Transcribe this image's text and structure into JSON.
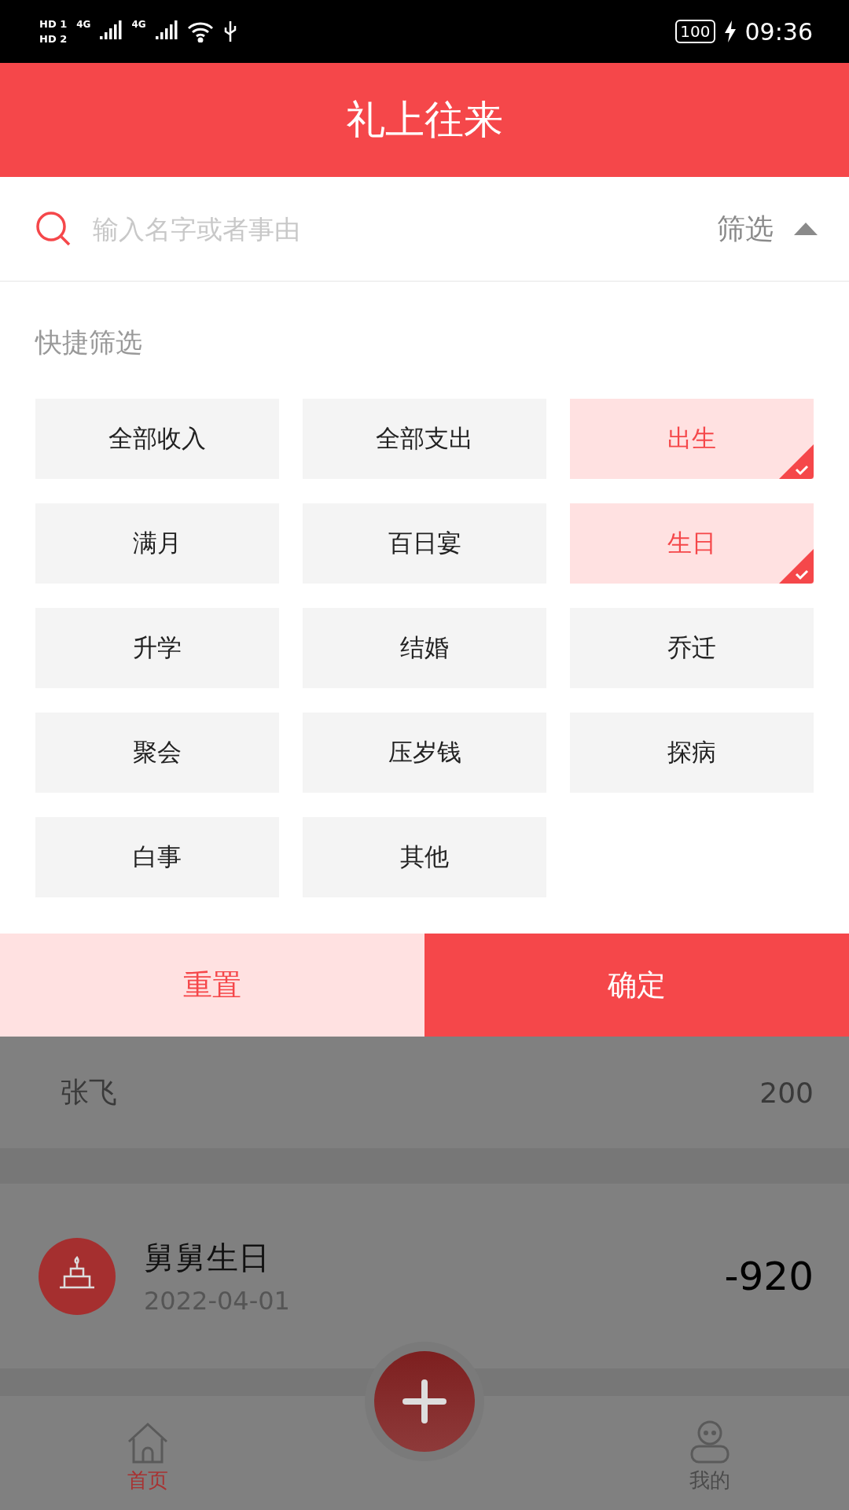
{
  "status_bar": {
    "sims": [
      {
        "label": "HD",
        "slot": "1"
      },
      {
        "label": "HD",
        "slot": "2"
      }
    ],
    "networks": [
      "4G",
      "4G"
    ],
    "battery": "100",
    "time": "09:36"
  },
  "header": {
    "title": "礼上往来"
  },
  "search": {
    "placeholder": "输入名字或者事由",
    "filter_label": "筛选",
    "filter_expanded": true
  },
  "quick_filter": {
    "title": "快捷筛选",
    "options": [
      {
        "label": "全部收入",
        "selected": false
      },
      {
        "label": "全部支出",
        "selected": false
      },
      {
        "label": "出生",
        "selected": true
      },
      {
        "label": "满月",
        "selected": false
      },
      {
        "label": "百日宴",
        "selected": false
      },
      {
        "label": "生日",
        "selected": true
      },
      {
        "label": "升学",
        "selected": false
      },
      {
        "label": "结婚",
        "selected": false
      },
      {
        "label": "乔迁",
        "selected": false
      },
      {
        "label": "聚会",
        "selected": false
      },
      {
        "label": "压岁钱",
        "selected": false
      },
      {
        "label": "探病",
        "selected": false
      },
      {
        "label": "白事",
        "selected": false
      },
      {
        "label": "其他",
        "selected": false
      }
    ]
  },
  "actions": [
    {
      "label": "重置",
      "kind": "secondary"
    },
    {
      "label": "确定",
      "kind": "primary"
    }
  ],
  "records": [
    {
      "kind": "summary",
      "name": "张飞",
      "amount": "200"
    },
    {
      "kind": "event",
      "title": "舅舅生日",
      "date": "2022-04-01",
      "amount": "-920"
    }
  ],
  "nav": {
    "items": [
      {
        "kind": "home",
        "label": "首页",
        "selected": true
      },
      {
        "kind": "profile",
        "label": "我的",
        "selected": false
      }
    ]
  }
}
